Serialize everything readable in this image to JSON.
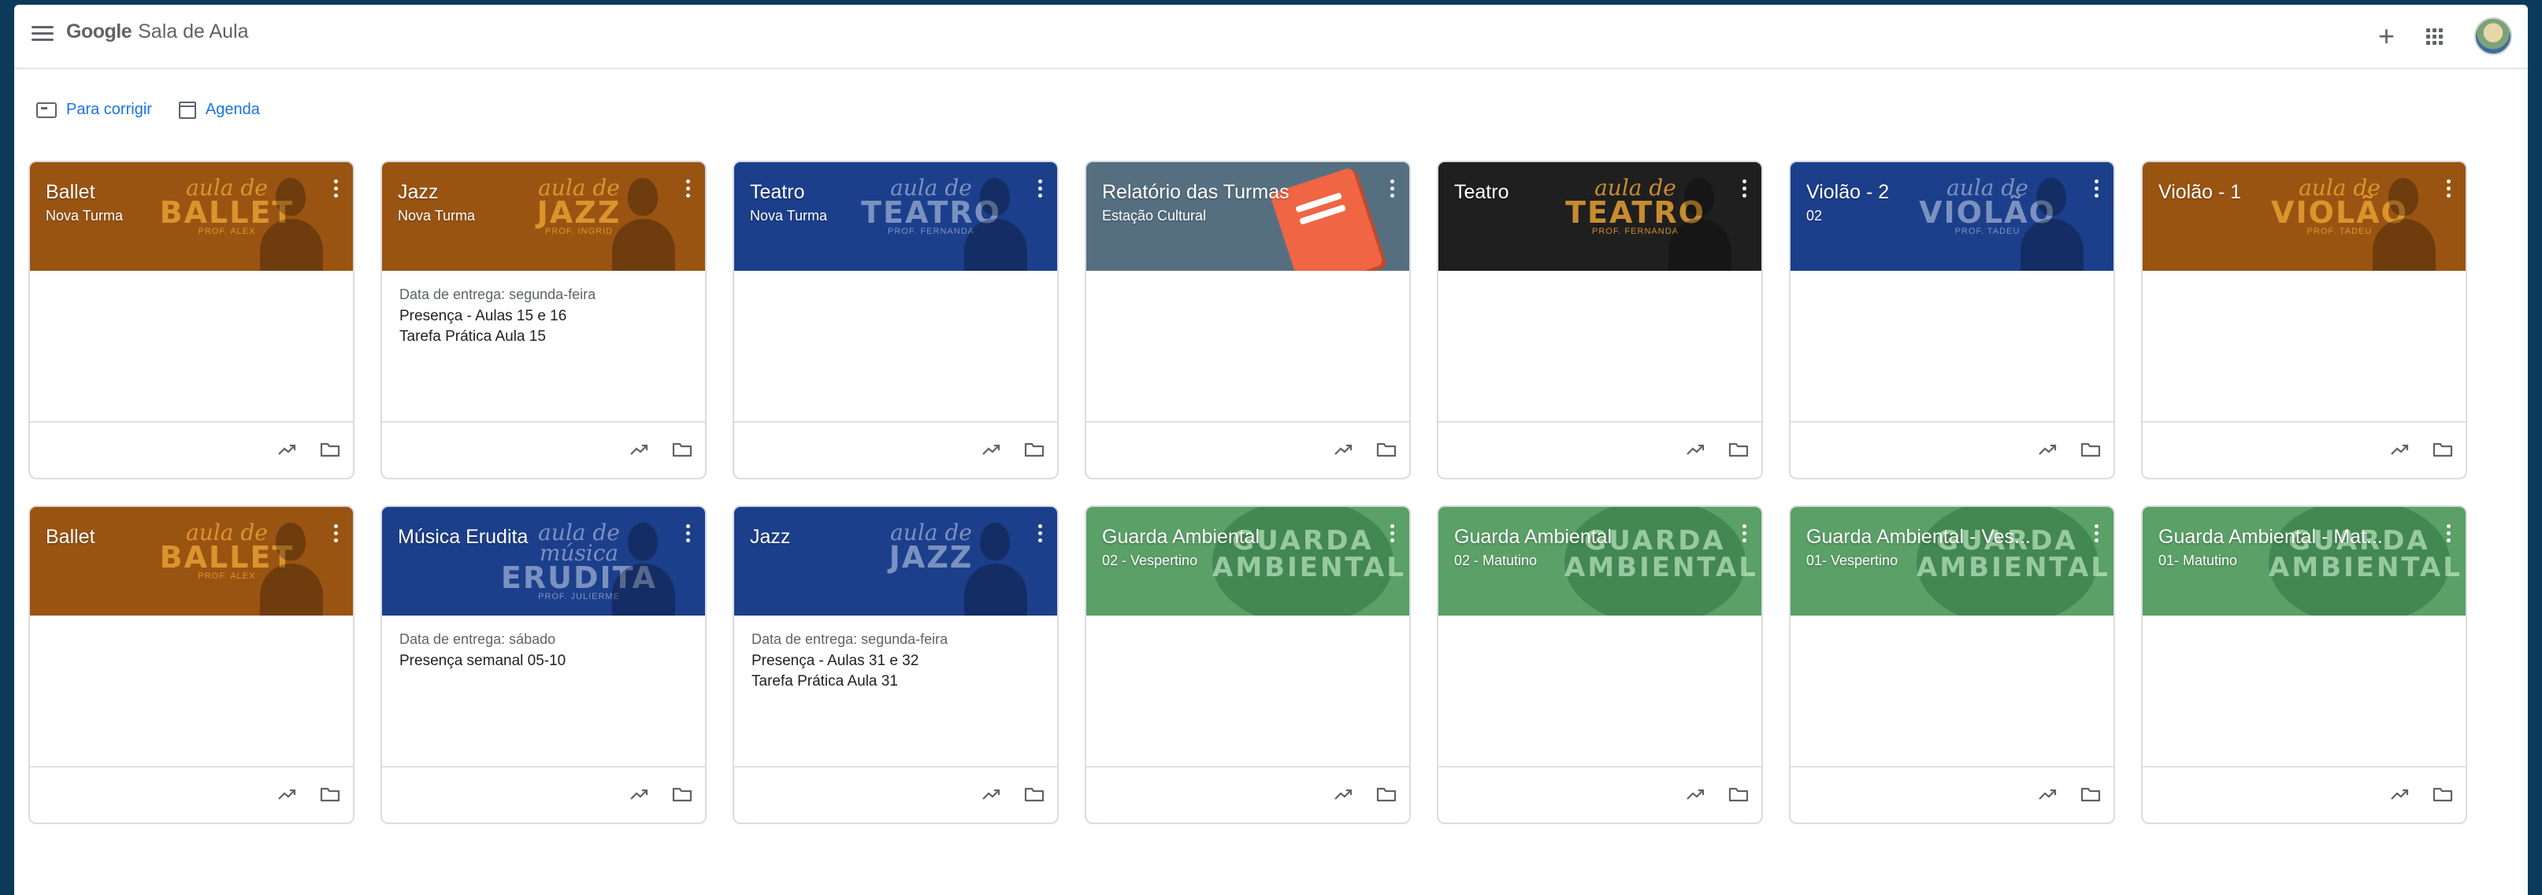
{
  "app": {
    "brand_google": "Google",
    "brand_product": "Sala de Aula",
    "icons": {
      "menu": "menu-icon",
      "add": "plus-icon",
      "apps": "apps-grid-icon",
      "avatar": "account-avatar"
    }
  },
  "subnav": {
    "to_review": "Para corrigir",
    "calendar": "Agenda"
  },
  "colors": {
    "orange": "#9a5412",
    "blue": "#1c3f8c",
    "slate": "#566f80",
    "dark": "#1f1f1f",
    "green": "#5aa067",
    "link": "#1a73e8"
  },
  "classes": [
    {
      "title": "Ballet",
      "subtitle": "Nova Turma",
      "theme": "orange",
      "art_script": "aula de",
      "art_big": "BALLET",
      "art_prof": "PROF. ALEX",
      "art": "banner",
      "due": "",
      "tasks": []
    },
    {
      "title": "Jazz",
      "subtitle": "Nova Turma",
      "theme": "orange",
      "art_script": "aula de",
      "art_big": "JAZZ",
      "art_prof": "PROF. INGRID",
      "art": "banner",
      "due": "Data de entrega: segunda-feira",
      "tasks": [
        "Presença - Aulas 15 e 16",
        "Tarefa Prática Aula 15"
      ]
    },
    {
      "title": "Teatro",
      "subtitle": "Nova Turma",
      "theme": "blue",
      "art_script": "aula de",
      "art_big": "TEATRO",
      "art_prof": "PROF. FERNANDA",
      "art": "banner",
      "due": "",
      "tasks": []
    },
    {
      "title": "Relatório das Turmas",
      "subtitle": "Estação Cultural",
      "theme": "slate",
      "art_script": "",
      "art_big": "",
      "art_prof": "",
      "art": "notebook",
      "due": "",
      "tasks": []
    },
    {
      "title": "Teatro",
      "subtitle": "",
      "theme": "dark",
      "art_script": "aula de",
      "art_big": "TEATRO",
      "art_prof": "PROF. FERNANDA",
      "art": "banner",
      "due": "",
      "tasks": []
    },
    {
      "title": "Violão - 2",
      "subtitle": "02",
      "theme": "blue",
      "art_script": "aula de",
      "art_big": "VIOLÃO",
      "art_prof": "PROF. TADEU",
      "art": "banner",
      "due": "",
      "tasks": []
    },
    {
      "title": "Violão - 1",
      "subtitle": "",
      "theme": "orange",
      "art_script": "aula de",
      "art_big": "VIOLÃO",
      "art_prof": "PROF. TADEU",
      "art": "banner",
      "due": "",
      "tasks": []
    },
    {
      "title": "Ballet",
      "subtitle": "",
      "theme": "orange",
      "art_script": "aula de",
      "art_big": "BALLET",
      "art_prof": "PROF. ALEX",
      "art": "banner",
      "due": "",
      "tasks": []
    },
    {
      "title": "Música Erudita",
      "subtitle": "",
      "theme": "blue",
      "art_script": "aula de música",
      "art_big": "ERUDITA",
      "art_prof": "PROF. JULIERME",
      "art": "banner",
      "due": "Data de entrega: sábado",
      "tasks": [
        "Presença semanal 05-10"
      ]
    },
    {
      "title": "Jazz",
      "subtitle": "",
      "theme": "blue",
      "art_script": "aula de",
      "art_big": "JAZZ",
      "art_prof": "",
      "art": "banner",
      "due": "Data de entrega: segunda-feira",
      "tasks": [
        "Presença - Aulas 31 e 32",
        "Tarefa Prática Aula 31"
      ]
    },
    {
      "title": "Guarda Ambiental",
      "subtitle": "02 - Vespertino",
      "theme": "green",
      "art_script": "",
      "art_big": "GUARDA AMBIENTAL",
      "art_prof": "",
      "art": "emblem",
      "due": "",
      "tasks": []
    },
    {
      "title": "Guarda Ambiental",
      "subtitle": "02 - Matutino",
      "theme": "green",
      "art_script": "",
      "art_big": "GUARDA AMBIENTAL",
      "art_prof": "",
      "art": "emblem",
      "due": "",
      "tasks": []
    },
    {
      "title": "Guarda Ambiental - Ves...",
      "subtitle": "01- Vespertino",
      "theme": "green",
      "art_script": "",
      "art_big": "GUARDA AMBIENTAL",
      "art_prof": "",
      "art": "emblem",
      "due": "",
      "tasks": []
    },
    {
      "title": "Guarda Ambiental - Mat...",
      "subtitle": "01- Matutino",
      "theme": "green",
      "art_script": "",
      "art_big": "GUARDA AMBIENTAL",
      "art_prof": "",
      "art": "emblem",
      "due": "",
      "tasks": []
    }
  ]
}
